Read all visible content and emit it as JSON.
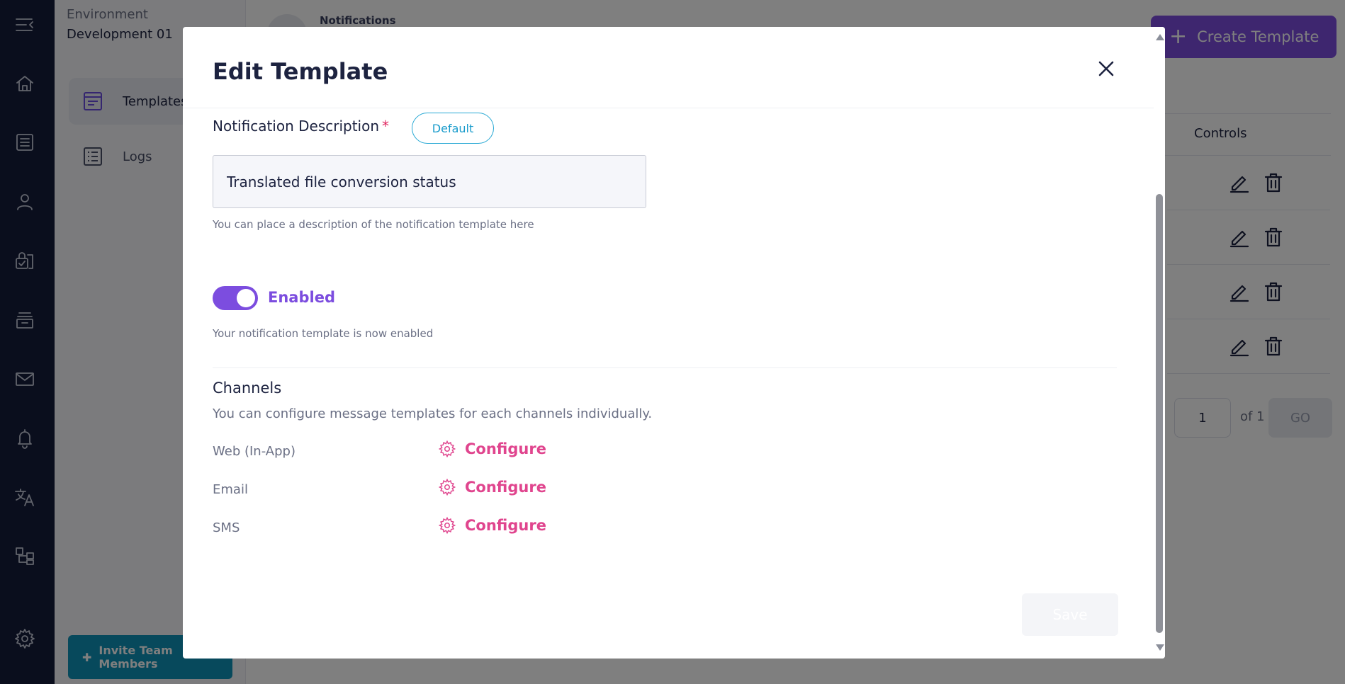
{
  "sidebar": {
    "env_label": "Environment",
    "env_value": "Development 01",
    "items": [
      {
        "label": "Templates"
      },
      {
        "label": "Logs"
      }
    ],
    "invite_label": "Invite Team Members"
  },
  "rail_icons": [
    "menu-collapse-icon",
    "home-icon",
    "list-icon",
    "user-icon",
    "secure-doc-icon",
    "archive-icon",
    "mail-icon",
    "bell-icon",
    "translate-icon",
    "workflow-icon",
    "gear-icon"
  ],
  "main": {
    "breadcrumb": "Notifications",
    "create_label": "Create Template",
    "controls_header": "Controls",
    "page_value": "1",
    "page_of": "of 1",
    "go_label": "GO"
  },
  "modal": {
    "title": "Edit Template",
    "description_label": "Notification Description",
    "required_mark": "*",
    "default_label": "Default",
    "description_value": "Translated file conversion status",
    "description_help": "You can place a description of the notification template here",
    "toggle_label": "Enabled",
    "toggle_on": true,
    "toggle_help": "Your notification template is now enabled",
    "channels_title": "Channels",
    "channels_sub": "You can configure message templates for each channels individually.",
    "channels": [
      {
        "name": "Web (In-App)",
        "action": "Configure"
      },
      {
        "name": "Email",
        "action": "Configure"
      },
      {
        "name": "SMS",
        "action": "Configure"
      }
    ],
    "save_label": "Save"
  },
  "colors": {
    "accent": "#7c4ddf",
    "configure": "#e0458e",
    "default_pill": "#27a8d4",
    "rail": "#141c3a"
  }
}
